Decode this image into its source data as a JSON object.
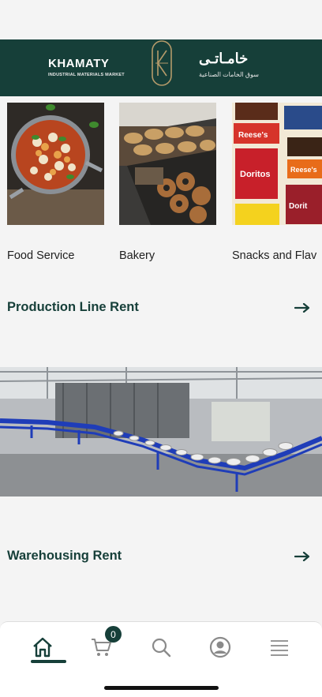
{
  "banner": {
    "brand_name": "KHAMATY",
    "brand_tagline": "INDUSTRIAL MATERIALS MARKET",
    "brand_name_ar": "خامـاتـى",
    "brand_tagline_ar": "سوق الخامات الصناعية",
    "color": "#163f39"
  },
  "categories": [
    {
      "label": "Food Service",
      "icon": "food-bowl-image"
    },
    {
      "label": "Bakery",
      "icon": "bakery-display-image"
    },
    {
      "label": "Snacks and Flav",
      "icon": "snacks-image"
    }
  ],
  "sections": [
    {
      "title": "Production Line Rent",
      "icon": "arrow-right-icon"
    },
    {
      "title": "Warehousing Rent",
      "icon": "arrow-right-icon"
    }
  ],
  "nav": {
    "items": [
      {
        "name": "home",
        "icon": "home-icon"
      },
      {
        "name": "cart",
        "icon": "cart-icon"
      },
      {
        "name": "search",
        "icon": "search-icon"
      },
      {
        "name": "account",
        "icon": "account-icon"
      },
      {
        "name": "menu",
        "icon": "menu-icon"
      }
    ],
    "cart_count": "0"
  }
}
